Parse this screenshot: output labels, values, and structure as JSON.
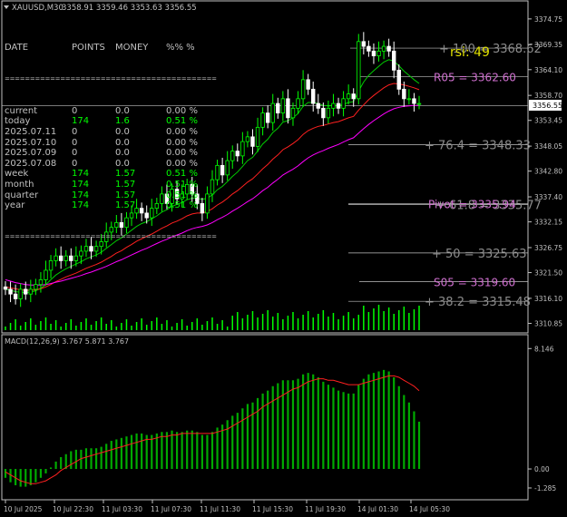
{
  "header": {
    "symbol": "XAUUSD,M30",
    "ohlc": "3358.91 3359.46 3353.63 3356.55"
  },
  "stats_table": {
    "columns": [
      "DATE",
      "POINTS",
      "MONEY",
      "%% %"
    ],
    "separator": "==========================================",
    "rows": [
      {
        "label": "current",
        "points": "0",
        "money": "0.0",
        "pct": "0.00 %",
        "color": "#c0c0c0"
      },
      {
        "label": "today",
        "points": "174",
        "money": "1.6",
        "pct": "0.51 %",
        "color": "#00ff00"
      },
      {
        "label": "2025.07.11",
        "points": "0",
        "money": "0.0",
        "pct": "0.00 %",
        "color": "#c0c0c0"
      },
      {
        "label": "2025.07.10",
        "points": "0",
        "money": "0.0",
        "pct": "0.00 %",
        "color": "#c0c0c0"
      },
      {
        "label": "2025.07.09",
        "points": "0",
        "money": "0.0",
        "pct": "0.00 %",
        "color": "#c0c0c0"
      },
      {
        "label": "2025.07.08",
        "points": "0",
        "money": "0.0",
        "pct": "0.00 %",
        "color": "#c0c0c0"
      },
      {
        "label": "week",
        "points": "174",
        "money": "1.57",
        "pct": "0.51 %",
        "color": "#00ff00"
      },
      {
        "label": "month",
        "points": "174",
        "money": "1.57",
        "pct": "0.51 %",
        "color": "#00ff00"
      },
      {
        "label": "quarter",
        "points": "174",
        "money": "1.57",
        "pct": "0.51 %",
        "color": "#00ff00"
      },
      {
        "label": "year",
        "points": "174",
        "money": "1.57",
        "pct": "0.51 %",
        "color": "#00ff00"
      }
    ]
  },
  "levels": [
    {
      "label": "+ 100 = 3368.62",
      "price": 3368.62,
      "color": "#8c8c8c"
    },
    {
      "label": "R05 = 3362.60",
      "price": 3362.6,
      "color": "#d070d0"
    },
    {
      "label": "+ 76.4  = 3348.33",
      "price": 3348.33,
      "color": "#8c8c8c"
    },
    {
      "label": "+ 61.8  = 3335.77",
      "price": 3335.77,
      "color": "#8c8c8c"
    },
    {
      "label": "Pivot = 3335.94",
      "price": 3335.94,
      "color": "#d070d0"
    },
    {
      "label": "+ 50  = 3325.63",
      "price": 3325.63,
      "color": "#8c8c8c"
    },
    {
      "label": "S05 = 3319.60",
      "price": 3319.6,
      "color": "#d070d0"
    },
    {
      "label": "+ 38.2  = 3315.48",
      "price": 3315.48,
      "color": "#8c8c8c"
    }
  ],
  "rsi_label": "rsi: 49",
  "current_price": "3356.55",
  "price_axis": [
    "3374.75",
    "3369.35",
    "3364.10",
    "3358.70",
    "3353.45",
    "3348.05",
    "3342.80",
    "3337.40",
    "3332.15",
    "3326.75",
    "3321.50",
    "3316.10",
    "3310.85"
  ],
  "price_range": [
    3309.8,
    3377.2
  ],
  "macd": {
    "label": "MACD(12,26,9) 3.767 5.871 3.767",
    "axis": [
      "8.146",
      "0.00",
      "-1.285"
    ],
    "range": [
      -1.9,
      8.9
    ]
  },
  "time_axis": [
    "10 Jul 2025",
    "10 Jul 22:30",
    "11 Jul 03:30",
    "11 Jul 07:30",
    "11 Jul 11:30",
    "11 Jul 15:30",
    "11 Jul 19:30",
    "14 Jul 01:30",
    "14 Jul 05:30"
  ],
  "colors": {
    "bull": "#00ff00",
    "bear": "#ffffff",
    "ma_fast": "#00cc00",
    "ma_mid": "#ff2020",
    "ma_slow": "#ff00ff",
    "macd_hist": "#00aa00",
    "macd_signal": "#ff2020",
    "grid": "#c0c0c0",
    "rsi": "#e0e000"
  },
  "chart_data": {
    "type": "line",
    "candles_close": [
      3318,
      3317,
      3316,
      3318,
      3317,
      3318,
      3319,
      3320,
      3322,
      3324,
      3325,
      3324,
      3325,
      3324,
      3325,
      3326,
      3327,
      3326,
      3327,
      3328,
      3330,
      3331,
      3332,
      3331,
      3333,
      3334,
      3335,
      3334,
      3333,
      3335,
      3336,
      3338,
      3336,
      3339,
      3337,
      3338,
      3340,
      3338,
      3336,
      3334,
      3338,
      3341,
      3344,
      3342,
      3345,
      3347,
      3346,
      3349,
      3350,
      3348,
      3352,
      3355,
      3353,
      3357,
      3355,
      3358,
      3354,
      3356,
      3358,
      3362,
      3360,
      3357,
      3356,
      3354,
      3356,
      3357,
      3356,
      3358,
      3359,
      3358,
      3370,
      3369,
      3368,
      3367,
      3368,
      3369,
      3368,
      3364,
      3360,
      3358,
      3358,
      3357,
      3357
    ],
    "ma_fast": [
      3318,
      3317.8,
      3317.5,
      3317.4,
      3317.3,
      3317.4,
      3317.7,
      3318.2,
      3319,
      3320,
      3321,
      3321.7,
      3322.3,
      3322.8,
      3323.3,
      3323.8,
      3324.4,
      3324.8,
      3325.2,
      3325.8,
      3326.6,
      3327.4,
      3328.2,
      3328.8,
      3329.6,
      3330.4,
      3331.2,
      3331.8,
      3332.2,
      3332.8,
      3333.4,
      3334.2,
      3334.7,
      3335.4,
      3335.8,
      3336.2,
      3336.8,
      3337.1,
      3337.1,
      3336.9,
      3337.1,
      3337.8,
      3338.9,
      3339.6,
      3340.6,
      3341.7,
      3342.6,
      3343.8,
      3345,
      3345.7,
      3347,
      3348.5,
      3349.5,
      3350.9,
      3351.8,
      3353.1,
      3353.4,
      3354,
      3354.9,
      3356.4,
      3357.2,
      3357.2,
      3357,
      3356.6,
      3356.5,
      3356.6,
      3356.5,
      3356.8,
      3357.2,
      3357.4,
      3359.6,
      3361.5,
      3362.9,
      3363.9,
      3364.8,
      3365.7,
      3366.2,
      3365.9,
      3364.9,
      3363.8,
      3362.9,
      3362,
      3361.2
    ],
    "ma_mid": [
      3318.5,
      3318.3,
      3318.1,
      3317.9,
      3317.8,
      3317.8,
      3317.9,
      3318.1,
      3318.5,
      3319,
      3319.6,
      3320.1,
      3320.6,
      3321,
      3321.4,
      3321.9,
      3322.4,
      3322.8,
      3323.2,
      3323.7,
      3324.3,
      3324.9,
      3325.6,
      3326.1,
      3326.8,
      3327.4,
      3328.1,
      3328.6,
      3329.1,
      3329.6,
      3330.2,
      3330.8,
      3331.3,
      3331.9,
      3332.3,
      3332.8,
      3333.4,
      3333.8,
      3334,
      3334,
      3334.3,
      3334.9,
      3335.7,
      3336.3,
      3337.1,
      3338,
      3338.7,
      3339.6,
      3340.5,
      3341.2,
      3342.2,
      3343.3,
      3344.2,
      3345.3,
      3346.2,
      3347.3,
      3347.9,
      3348.6,
      3349.4,
      3350.5,
      3351.3,
      3351.8,
      3352.2,
      3352.4,
      3352.7,
      3353,
      3353.2,
      3353.6,
      3354,
      3354.3,
      3355.6,
      3356.7,
      3357.8,
      3358.7,
      3359.5,
      3360.3,
      3360.9,
      3361.2,
      3361.1,
      3360.9,
      3360.6,
      3360.3,
      3359.9
    ],
    "ma_slow": [
      3320,
      3319.7,
      3319.4,
      3319.2,
      3319,
      3318.9,
      3318.9,
      3318.9,
      3319,
      3319.2,
      3319.5,
      3319.7,
      3320,
      3320.3,
      3320.6,
      3320.9,
      3321.3,
      3321.6,
      3322,
      3322.4,
      3322.8,
      3323.3,
      3323.8,
      3324.2,
      3324.7,
      3325.2,
      3325.7,
      3326.2,
      3326.6,
      3327.1,
      3327.6,
      3328.1,
      3328.5,
      3329,
      3329.4,
      3329.8,
      3330.3,
      3330.7,
      3331,
      3331.2,
      3331.5,
      3332,
      3332.6,
      3333.1,
      3333.7,
      3334.4,
      3335,
      3335.7,
      3336.4,
      3337,
      3337.8,
      3338.7,
      3339.4,
      3340.3,
      3341.1,
      3342,
      3342.6,
      3343.2,
      3343.9,
      3344.8,
      3345.6,
      3346.2,
      3346.7,
      3347.1,
      3347.6,
      3348,
      3348.4,
      3348.9,
      3349.4,
      3349.8,
      3350.8,
      3351.7,
      3352.6,
      3353.4,
      3354.1,
      3354.8,
      3355.4,
      3355.9,
      3356.2,
      3356.4,
      3356.5,
      3356.6,
      3356.6
    ],
    "macd_histogram": [
      -0.6,
      -0.9,
      -1.1,
      -1.2,
      -1.2,
      -1.1,
      -0.9,
      -0.6,
      -0.3,
      0.1,
      0.5,
      0.8,
      1.0,
      1.2,
      1.3,
      1.3,
      1.4,
      1.4,
      1.4,
      1.5,
      1.7,
      1.9,
      2.0,
      2.1,
      2.2,
      2.3,
      2.4,
      2.4,
      2.3,
      2.3,
      2.4,
      2.5,
      2.5,
      2.6,
      2.5,
      2.5,
      2.6,
      2.6,
      2.5,
      2.3,
      2.3,
      2.5,
      2.8,
      3.0,
      3.3,
      3.6,
      3.8,
      4.1,
      4.4,
      4.5,
      4.8,
      5.1,
      5.3,
      5.6,
      5.8,
      6.0,
      6.0,
      6.0,
      6.1,
      6.4,
      6.5,
      6.4,
      6.2,
      5.9,
      5.7,
      5.5,
      5.3,
      5.2,
      5.1,
      5.1,
      5.7,
      6.1,
      6.4,
      6.5,
      6.6,
      6.7,
      6.6,
      6.2,
      5.6,
      5.0,
      4.5,
      3.9,
      3.2
    ],
    "macd_signal": [
      -0.2,
      -0.4,
      -0.6,
      -0.8,
      -0.9,
      -1.0,
      -1.0,
      -0.9,
      -0.8,
      -0.6,
      -0.4,
      -0.1,
      0.1,
      0.3,
      0.5,
      0.7,
      0.8,
      0.9,
      1.0,
      1.1,
      1.2,
      1.3,
      1.4,
      1.5,
      1.6,
      1.7,
      1.8,
      1.9,
      2.0,
      2.0,
      2.1,
      2.2,
      2.2,
      2.3,
      2.3,
      2.4,
      2.4,
      2.4,
      2.4,
      2.4,
      2.4,
      2.4,
      2.5,
      2.6,
      2.7,
      2.9,
      3.1,
      3.3,
      3.5,
      3.7,
      3.9,
      4.2,
      4.4,
      4.6,
      4.8,
      5.0,
      5.2,
      5.4,
      5.5,
      5.7,
      5.9,
      6.0,
      6.1,
      6.1,
      6.0,
      6.0,
      5.9,
      5.8,
      5.7,
      5.7,
      5.7,
      5.8,
      5.9,
      6.0,
      6.1,
      6.2,
      6.3,
      6.3,
      6.2,
      6.0,
      5.8,
      5.6,
      5.3
    ]
  }
}
